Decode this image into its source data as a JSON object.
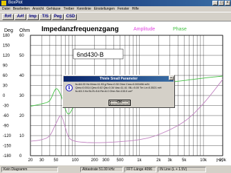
{
  "window": {
    "title": "BoxPlot"
  },
  "menu": [
    "Datei",
    "Bearbeiten",
    "Ansicht",
    "Gehäuse",
    "Treiber",
    "Kennlinie",
    "Einstellungen",
    "Fenster",
    "Hilfe"
  ],
  "toolbar": [
    "R#f",
    "A#f",
    "Imp",
    "T/S",
    "Peg",
    "CSD"
  ],
  "chart": {
    "title": "Impedanzfrequenzgang",
    "series_amplitude": "Amplitude",
    "series_phase": "Phase",
    "left_axis_label": "Deg",
    "right_axis_label": "Ohm",
    "driver_label": "6nd430-B",
    "x_unit": "[Hz]",
    "deg_ticks": [
      "180",
      "150",
      "120",
      "90",
      "60",
      "30",
      "0",
      "-30",
      "-60",
      "-90",
      "-120",
      "-150",
      "-180"
    ],
    "ohm_ticks": [
      "60",
      "50",
      "40",
      "30",
      "20",
      "10",
      "0"
    ],
    "x_ticks": [
      "20",
      "30",
      "50",
      "100",
      "200",
      "300",
      "500",
      "1k",
      "2k",
      "3k",
      "5k",
      "10k",
      "20k"
    ],
    "colors": {
      "amplitude": "#e040e0",
      "phase": "#40c040",
      "curve_imp": "#c080c0",
      "curve_phase": "#40c040",
      "grid": "#000000"
    }
  },
  "chart_data": {
    "type": "line",
    "title": "Impedanzfrequenzgang",
    "xlabel": "[Hz]",
    "ylabel_left": "Deg",
    "ylabel_right": "Ohm",
    "xscale": "log",
    "xlim": [
      20,
      20000
    ],
    "ylim_left": [
      -180,
      180
    ],
    "ylim_right": [
      0,
      60
    ],
    "grid": true,
    "series": [
      {
        "name": "Amplitude",
        "x": [
          20,
          30,
          40,
          50,
          60,
          70,
          80,
          100,
          150,
          200,
          300,
          500,
          1000,
          2000,
          5000,
          10000,
          20000
        ],
        "y": [
          7.2,
          8.0,
          10.0,
          16.0,
          20.0,
          14.0,
          9.0,
          7.2,
          6.6,
          6.5,
          6.6,
          7.0,
          8.0,
          10.5,
          17.0,
          26.0,
          38.0
        ]
      },
      {
        "name": "Phase",
        "x": [
          20,
          30,
          40,
          50,
          60,
          70,
          80,
          100,
          150,
          200,
          300,
          500,
          1000,
          2000,
          5000,
          10000,
          20000
        ],
        "y": [
          -32,
          -25,
          -15,
          20,
          0,
          -40,
          -55,
          -28,
          -5,
          -2,
          3,
          10,
          22,
          35,
          45,
          52,
          58
        ]
      }
    ]
  },
  "dialog": {
    "title": "Thiele Small Parameter",
    "line1": "fs=64.00 Hz   Mms=11.93 g   Rms=0.30 Ohm   Cms=0.000496 m/N",
    "line2": "Qms=0.0014   Qes=0.62   Qts=0.34   Vas=11.41 l   BL=5.00 Tm   Le=0.3521 mH",
    "line3": "fs=63.3 Hz   BL/S=5.6   Re=6.0 Ohm   Sd=133.0 cm²",
    "ok_label": "OK"
  },
  "status": {
    "left": "Kein Diagramm",
    "sample_rate": "Abtastrate 51.00 kHz",
    "fft": "FFT-Länge 4096",
    "input": "IN Line (L + 1.5V)"
  }
}
